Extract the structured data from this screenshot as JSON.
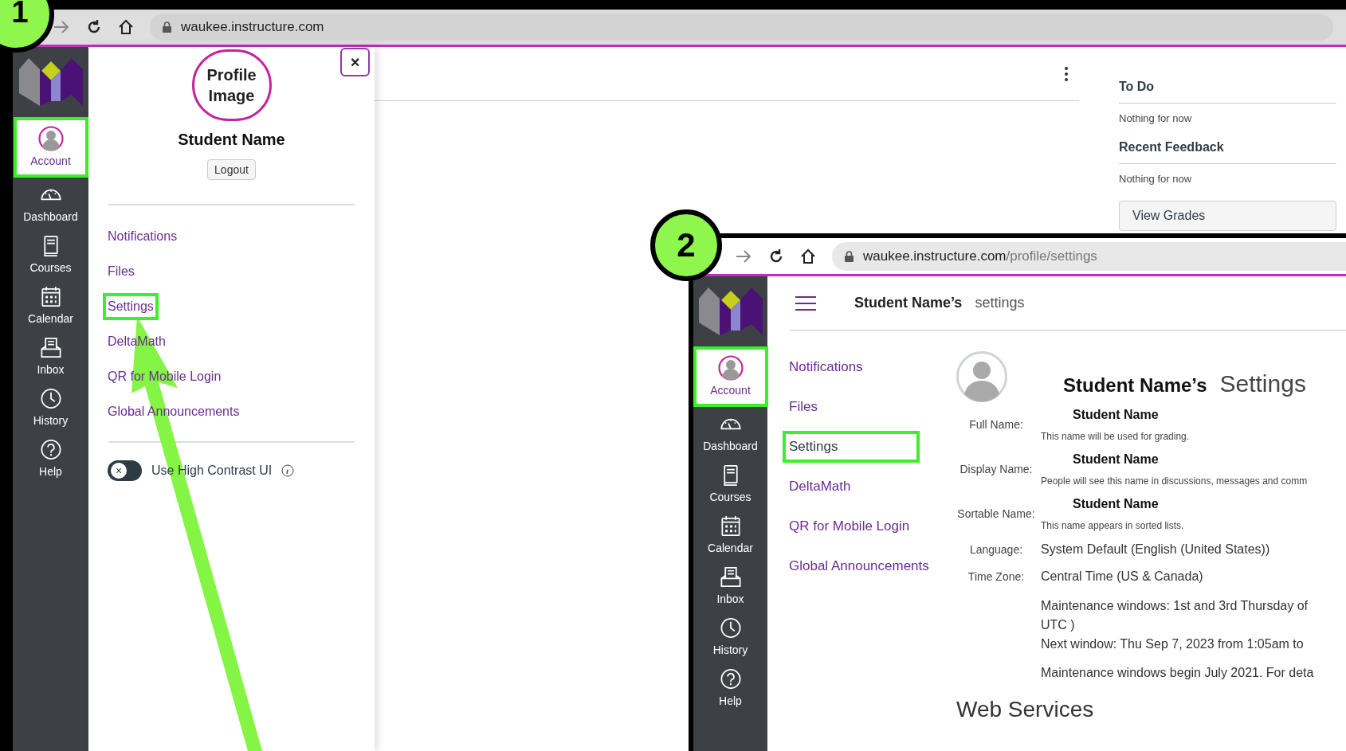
{
  "badges": [
    "1",
    "2"
  ],
  "screen_1": {
    "address": "waukee.instructure.com",
    "nav": [
      {
        "label": "Account",
        "selected": true,
        "highlighted": true
      },
      {
        "label": "Dashboard",
        "selected": false,
        "highlighted": false
      },
      {
        "label": "Courses",
        "selected": false,
        "highlighted": false
      },
      {
        "label": "Calendar",
        "selected": false,
        "highlighted": false
      },
      {
        "label": "Inbox",
        "selected": false,
        "highlighted": false
      },
      {
        "label": "History",
        "selected": false,
        "highlighted": false
      },
      {
        "label": "Help",
        "selected": false,
        "highlighted": false
      }
    ],
    "tray": {
      "close": "×",
      "profile_image": "Profile Image",
      "student_name": "Student Name",
      "logout": "Logout",
      "links": [
        {
          "label": "Notifications",
          "highlighted": false
        },
        {
          "label": "Files",
          "highlighted": false
        },
        {
          "label": "Settings",
          "highlighted": true
        },
        {
          "label": "DeltaMath",
          "highlighted": false
        },
        {
          "label": "QR for Mobile Login",
          "highlighted": false
        },
        {
          "label": "Global Announcements",
          "highlighted": false
        }
      ],
      "toggle": {
        "label": "Use High Contrast UI",
        "on": false,
        "knob": "×"
      }
    },
    "sidebar": {
      "sections": [
        {
          "title": "To Do",
          "text": "Nothing for now"
        },
        {
          "title": "Recent Feedback",
          "text": "Nothing for now"
        }
      ],
      "button": "View Grades"
    }
  },
  "screen_2": {
    "address": {
      "domain": "waukee.instructure.com",
      "path": "/profile/settings"
    },
    "nav": [
      {
        "label": "Account",
        "selected": true,
        "highlighted": true
      },
      {
        "label": "Dashboard",
        "selected": false,
        "highlighted": false
      },
      {
        "label": "Courses",
        "selected": false,
        "highlighted": false
      },
      {
        "label": "Calendar",
        "selected": false,
        "highlighted": false
      },
      {
        "label": "Inbox",
        "selected": false,
        "highlighted": false
      },
      {
        "label": "History",
        "selected": false,
        "highlighted": false
      },
      {
        "label": "Help",
        "selected": false,
        "highlighted": false
      }
    ],
    "header": {
      "name": "Student Name’s",
      "page": "settings"
    },
    "links": [
      {
        "label": "Notifications",
        "selected": false,
        "highlighted": false
      },
      {
        "label": "Files",
        "selected": false,
        "highlighted": false
      },
      {
        "label": "Settings",
        "selected": true,
        "highlighted": true
      },
      {
        "label": "DeltaMath",
        "selected": false,
        "highlighted": false
      },
      {
        "label": "QR for Mobile Login",
        "selected": false,
        "highlighted": false
      },
      {
        "label": "Global Announcements",
        "selected": false,
        "highlighted": false
      }
    ],
    "heading": {
      "name": "Student Name’s",
      "title": "Settings"
    },
    "fields": [
      {
        "kind": "name",
        "label": "Full Name:",
        "value": "Student Name",
        "hint": "This name will be used for grading."
      },
      {
        "kind": "name",
        "label": "Display Name:",
        "value": "Student Name",
        "hint": "People will see this name in discussions, messages and comm"
      },
      {
        "kind": "name",
        "label": "Sortable Name:",
        "value": "Student Name",
        "hint": "This name appears in sorted lists."
      },
      {
        "kind": "plain",
        "label": "Language:",
        "value": "System Default (English (United States))"
      },
      {
        "kind": "plain",
        "label": "Time Zone:",
        "value": "Central Time (US & Canada)"
      }
    ],
    "maintenance": [
      "Maintenance windows: 1st and 3rd Thursday of",
      "UTC )",
      "Next window: Thu Sep 7, 2023 from 1:05am to",
      "Maintenance windows begin July 2021. For deta"
    ],
    "section_title": "Web Services"
  }
}
